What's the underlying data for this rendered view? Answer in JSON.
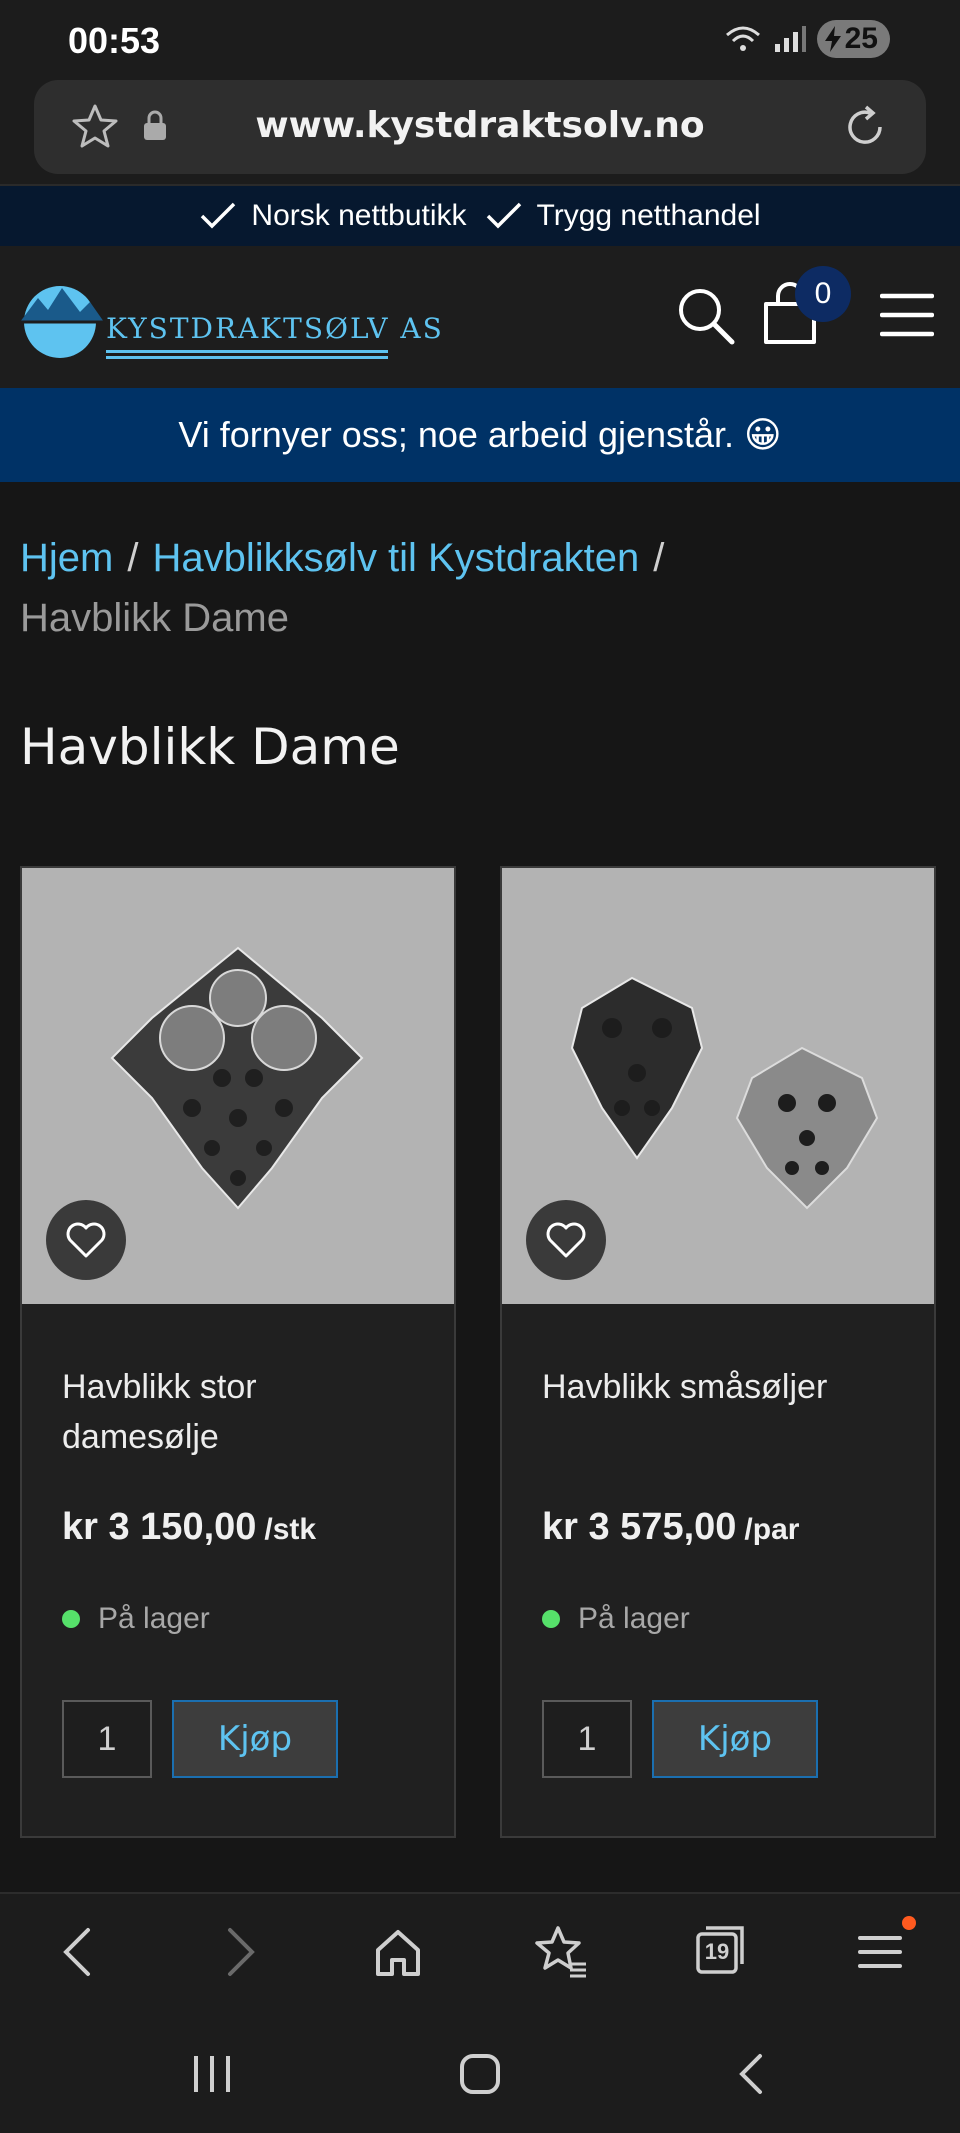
{
  "status": {
    "time": "00:53",
    "battery": "25"
  },
  "browser": {
    "url": "www.kystdraktsolv.no",
    "tab_count": "19"
  },
  "promo": {
    "items": [
      "Norsk nettbutikk",
      "Trygg netthandel"
    ]
  },
  "header": {
    "logo_text": "KYSTDRAKTSØLV AS",
    "cart_count": "0"
  },
  "notice": {
    "text": "Vi fornyer oss; noe arbeid gjenstår. 😀"
  },
  "breadcrumb": {
    "home": "Hjem",
    "category": "Havblikksølv til Kystdrakten",
    "current": "Havblikk Dame",
    "separator": "/"
  },
  "page": {
    "title": "Havblikk Dame"
  },
  "products": [
    {
      "name": "Havblikk stor damesølje",
      "price": "kr 3 150,00",
      "unit": "/stk",
      "stock": "På lager",
      "qty": "1",
      "buy_label": "Kjøp"
    },
    {
      "name": "Havblikk småsøljer",
      "price": "kr 3 575,00",
      "unit": "/par",
      "stock": "På lager",
      "qty": "1",
      "buy_label": "Kjøp"
    }
  ],
  "colors": {
    "accent": "#5ec3f0",
    "notice_bg": "#003266",
    "promo_bg": "#06182f",
    "in_stock": "#56e06a"
  }
}
